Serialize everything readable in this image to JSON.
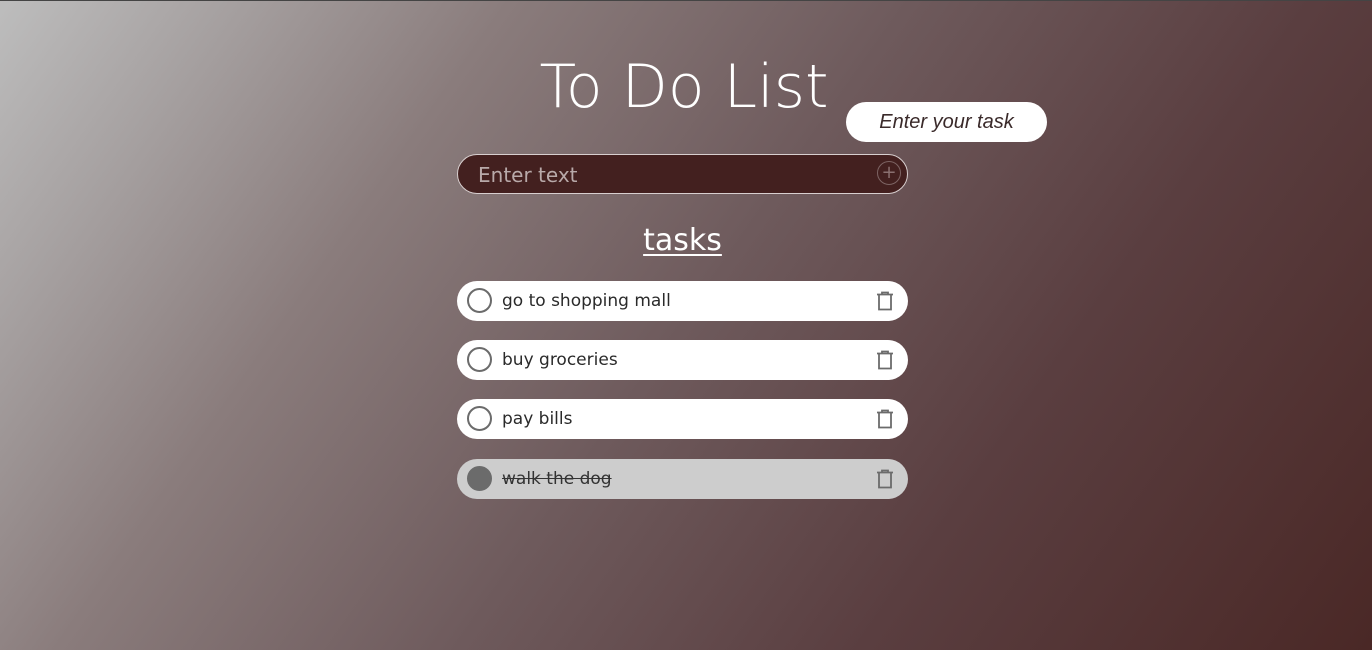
{
  "app": {
    "title": "To Do List",
    "tooltip": "Enter your task"
  },
  "input": {
    "placeholder": "Enter text",
    "value": "",
    "add_icon": "plus-circle-icon",
    "add_symbol": "+"
  },
  "tasks_heading": "tasks",
  "tasks": [
    {
      "text": "go to shopping mall",
      "completed": false,
      "delete_icon": "trash-icon"
    },
    {
      "text": "buy groceries",
      "completed": false,
      "delete_icon": "trash-icon"
    },
    {
      "text": "pay bills",
      "completed": false,
      "delete_icon": "trash-icon"
    },
    {
      "text": "walk the dog",
      "completed": true,
      "delete_icon": "trash-icon"
    }
  ],
  "colors": {
    "input_background": "#43201f",
    "task_background": "#ffffff",
    "completed_task_background": "#cdcdcd",
    "check_color": "#6b6b6b"
  }
}
